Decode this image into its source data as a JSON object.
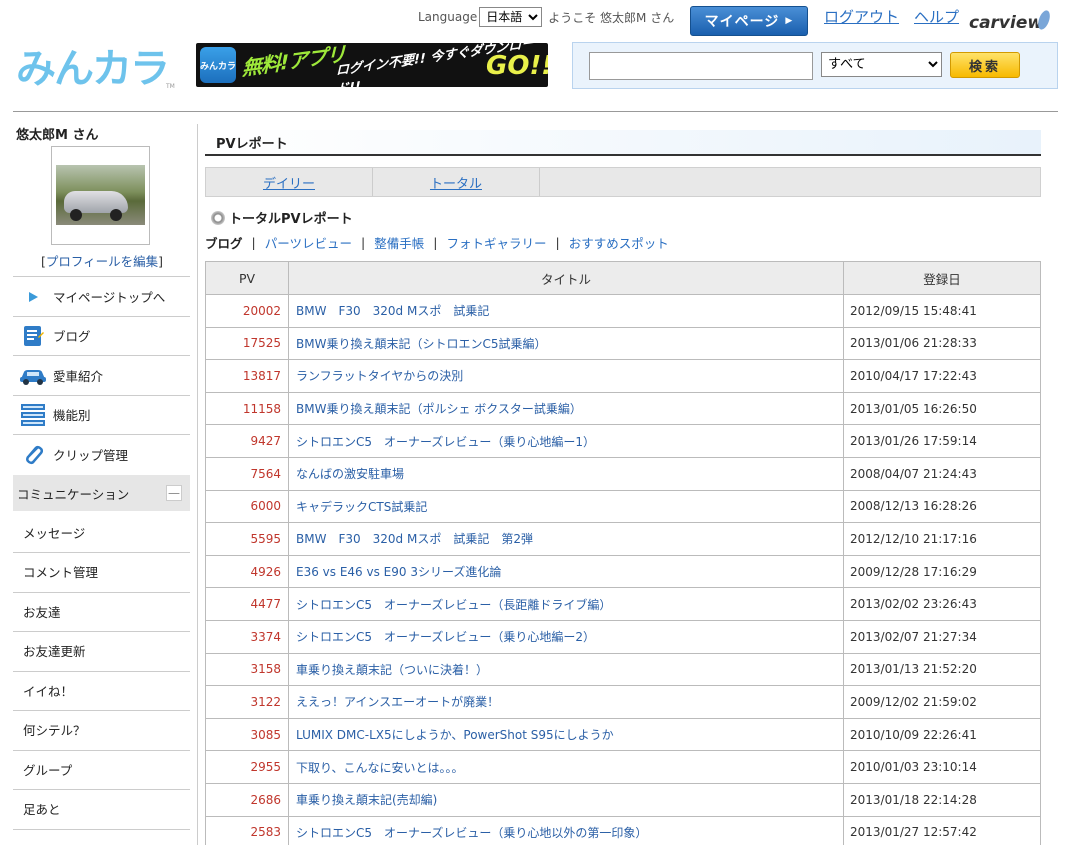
{
  "header": {
    "language_label": "Language",
    "language_value": "日本語",
    "welcome": "ようこそ 悠太郎M さん",
    "mypage_label": "マイページ",
    "logout_label": "ログアウト",
    "help_label": "ヘルプ",
    "carview_label": "carview",
    "logo_text": "みんカラ",
    "banner": {
      "app_label": "みんカラ",
      "line1": "無料!アプリ",
      "line2": "ログイン不要!! 今すぐダウンロード!!",
      "line3": "GO!!"
    },
    "search": {
      "value": "",
      "scope": "すべて",
      "button_label": "検索"
    }
  },
  "sidebar": {
    "user_name": "悠太郎M さん",
    "edit_profile": "プロフィールを編集",
    "nav": [
      {
        "label": "マイページトップへ",
        "icon": "triangle-right-icon"
      },
      {
        "label": "ブログ",
        "icon": "blog-icon"
      },
      {
        "label": "愛車紹介",
        "icon": "car-icon"
      },
      {
        "label": "機能別",
        "icon": "list-icon"
      },
      {
        "label": "クリップ管理",
        "icon": "paperclip-icon"
      }
    ],
    "community_header": "コミュニケーション",
    "community": [
      "メッセージ",
      "コメント管理",
      "お友達",
      "お友達更新",
      "イイね！",
      "何シテル？",
      "グループ",
      "足あと"
    ]
  },
  "main": {
    "title": "PVレポート",
    "tabs": [
      "デイリー",
      "トータル"
    ],
    "report_heading": "トータルPVレポート",
    "categories": {
      "current": "ブログ",
      "links": [
        "パーツレビュー",
        "整備手帳",
        "フォトギャラリー",
        "おすすめスポット"
      ]
    },
    "table": {
      "columns": [
        "PV",
        "タイトル",
        "登録日"
      ],
      "rows": [
        {
          "pv": "20002",
          "title": "BMW　F30　320d Mスポ　試乗記",
          "date": "2012/09/15 15:48:41"
        },
        {
          "pv": "17525",
          "title": "BMW乗り換え顛末記（シトロエンC5試乗編）",
          "date": "2013/01/06 21:28:33"
        },
        {
          "pv": "13817",
          "title": "ランフラットタイヤからの決別",
          "date": "2010/04/17 17:22:43"
        },
        {
          "pv": "11158",
          "title": "BMW乗り換え顛末記（ポルシェ ボクスター試乗編）",
          "date": "2013/01/05 16:26:50"
        },
        {
          "pv": "9427",
          "title": "シトロエンC5　オーナーズレビュー（乗り心地編ー1）",
          "date": "2013/01/26 17:59:14"
        },
        {
          "pv": "7564",
          "title": "なんばの激安駐車場",
          "date": "2008/04/07 21:24:43"
        },
        {
          "pv": "6000",
          "title": "キャデラックCTS試乗記",
          "date": "2008/12/13 16:28:26"
        },
        {
          "pv": "5595",
          "title": "BMW　F30　320d Mスポ　試乗記　第2弾",
          "date": "2012/12/10 21:17:16"
        },
        {
          "pv": "4926",
          "title": "E36 vs E46 vs E90 3シリーズ進化論",
          "date": "2009/12/28 17:16:29"
        },
        {
          "pv": "4477",
          "title": "シトロエンC5　オーナーズレビュー（長距離ドライブ編）",
          "date": "2013/02/02 23:26:43"
        },
        {
          "pv": "3374",
          "title": "シトロエンC5　オーナーズレビュー（乗り心地編ー2）",
          "date": "2013/02/07 21:27:34"
        },
        {
          "pv": "3158",
          "title": "車乗り換え顛末記（ついに決着！）",
          "date": "2013/01/13 21:52:20"
        },
        {
          "pv": "3122",
          "title": "ええっ！アインスエーオートが廃業！",
          "date": "2009/12/02 21:59:02"
        },
        {
          "pv": "3085",
          "title": "LUMIX DMC-LX5にしようか、PowerShot S95にしようか",
          "date": "2010/10/09 22:26:41"
        },
        {
          "pv": "2955",
          "title": "下取り、こんなに安いとは。。。",
          "date": "2010/01/03 23:10:14"
        },
        {
          "pv": "2686",
          "title": "車乗り換え顛末記(売却編)",
          "date": "2013/01/18 22:14:28"
        },
        {
          "pv": "2583",
          "title": "シトロエンC5　オーナーズレビュー（乗り心地以外の第一印象）",
          "date": "2013/01/27 12:57:42"
        }
      ]
    }
  },
  "colors": {
    "pv_number": "#c0362c",
    "link": "#2a6fc2",
    "search_button": "#f7b900",
    "mypage_button": "#1a5fae"
  }
}
